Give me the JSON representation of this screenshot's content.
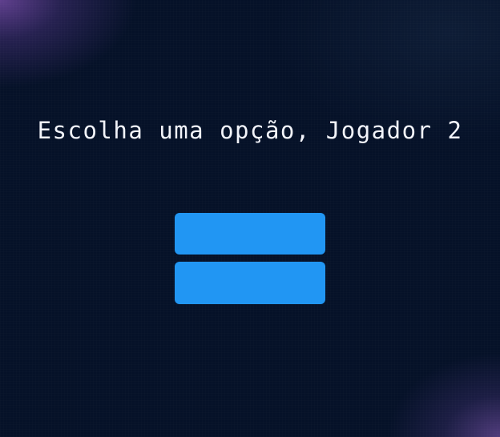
{
  "prompt": {
    "title": "Escolha uma opção, Jogador 2"
  },
  "options": [
    {
      "label": ""
    },
    {
      "label": ""
    }
  ],
  "colors": {
    "background": "#051128",
    "accent_glow": "#784caa",
    "button": "#2196f3",
    "text": "#f2f4fa"
  }
}
